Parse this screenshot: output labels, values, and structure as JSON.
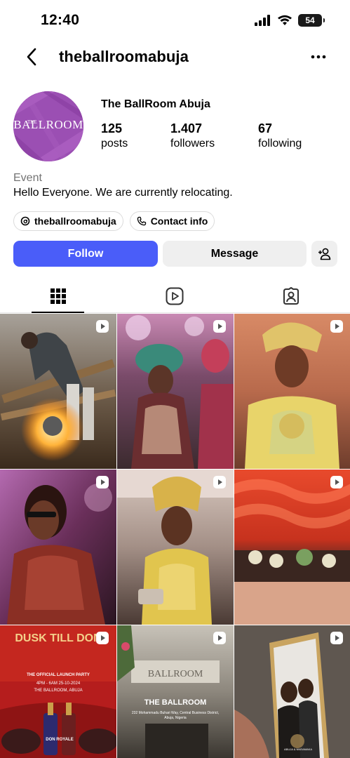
{
  "status_bar": {
    "time": "12:40",
    "battery": "54",
    "icons": [
      "signal-icon",
      "wifi-icon",
      "battery-icon"
    ]
  },
  "header": {
    "username": "theballroomabuja",
    "back_icon": "chevron-left-icon",
    "more_icon": "ellipsis-icon"
  },
  "profile": {
    "avatar_text": "BALLROOM",
    "avatar_prefix": "THE",
    "display_name": "The BallRoom Abuja",
    "stats": [
      {
        "value": "125",
        "label": "posts"
      },
      {
        "value": "1.407",
        "label": "followers"
      },
      {
        "value": "67",
        "label": "following"
      }
    ],
    "category": "Event",
    "bio": "Hello Everyone. We are currently relocating."
  },
  "chips": [
    {
      "label": "theballroomabuja",
      "icon": "threads-icon"
    },
    {
      "label": "Contact info",
      "icon": "phone-icon"
    }
  ],
  "actions": {
    "follow": "Follow",
    "message": "Message",
    "add_user_icon": "add-user-icon"
  },
  "tabs": [
    {
      "name": "grid",
      "icon": "grid-icon",
      "active": true
    },
    {
      "name": "reels",
      "icon": "reels-icon",
      "active": false
    },
    {
      "name": "tagged",
      "icon": "tagged-icon",
      "active": false
    }
  ],
  "posts": [
    {
      "type": "reel",
      "alt": "Worker cutting metal with sparks"
    },
    {
      "type": "reel",
      "alt": "Bride dancing at wedding"
    },
    {
      "type": "reel",
      "alt": "Bride in gold gele"
    },
    {
      "type": "reel",
      "alt": "Guest at party"
    },
    {
      "type": "reel",
      "alt": "Bride in gold dress"
    },
    {
      "type": "reel",
      "alt": "Red decorated ballroom"
    },
    {
      "type": "reel",
      "title": "DUSK TILL DON",
      "subtitle": "THE OFFICIAL LAUNCH PARTY",
      "details": "4PM - 6AM   25-10-2024",
      "venue": "THE BALLROOM, ABUJA",
      "bottle_label": "DON ROYALE"
    },
    {
      "type": "reel",
      "title": "THE BALLROOM",
      "address": "232 Mohammadu Buhari Way, Central Business District, Abuja, Nigeria",
      "sign": "BALLROOM"
    },
    {
      "type": "reel",
      "caption": "ABUJA & NNEAMAKA"
    }
  ],
  "colors": {
    "follow_button": "#4a5df9",
    "secondary_button": "#efefef",
    "muted_text": "#737373",
    "border": "#dbdbdb"
  }
}
